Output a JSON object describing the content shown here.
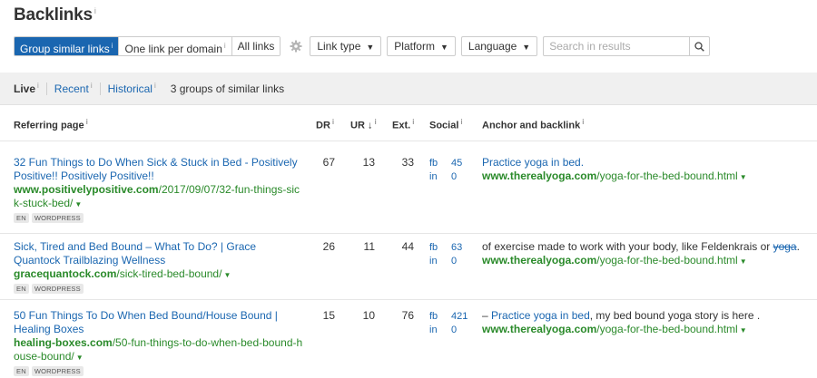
{
  "page": {
    "title": "Backlinks",
    "info": "i"
  },
  "toolbar": {
    "group_similar": "Group similar links",
    "one_per_domain": "One link per domain",
    "all_links": "All links",
    "info": "i",
    "link_type": "Link type",
    "platform": "Platform",
    "language": "Language",
    "search_placeholder": "Search in results",
    "active_color": "#1a66b0"
  },
  "tabs": {
    "live": "Live",
    "recent": "Recent",
    "historical": "Historical",
    "info": "i",
    "summary": "3 groups of similar links"
  },
  "columns": {
    "referring_page": "Referring page",
    "dr": "DR",
    "ur": "UR",
    "ur_sort": "↓",
    "ext": "Ext.",
    "social": "Social",
    "anchor": "Anchor and backlink",
    "info": "i"
  },
  "rows": [
    {
      "title": "32 Fun Things to Do When Sick & Stuck in Bed - Positively Positive!! Positively Positive!!",
      "domain": "www.positivelypositive.com",
      "path": "/2017/09/07/32-fun-things-sick-stuck-bed/",
      "tags": [
        "EN",
        "WORDPRESS"
      ],
      "dr": "67",
      "ur": "13",
      "ext": "33",
      "fb_label": "fb",
      "fb": "45",
      "in_label": "in",
      "in": "0",
      "anchor_before": "",
      "anchor_link": "Practice yoga in bed.",
      "anchor_strike": "",
      "anchor_after": "",
      "backlink_domain": "www.therealyoga.com",
      "backlink_path": "/yoga-for-the-bed-bound.html"
    },
    {
      "title": "Sick, Tired and Bed Bound – What To Do? | Grace Quantock Trailblazing Wellness",
      "domain": "gracequantock.com",
      "path": "/sick-tired-bed-bound/",
      "tags": [
        "EN",
        "WORDPRESS"
      ],
      "dr": "26",
      "ur": "11",
      "ext": "44",
      "fb_label": "fb",
      "fb": "63",
      "in_label": "in",
      "in": "0",
      "anchor_before": "of exercise made to work with your body, like Feldenkrais or ",
      "anchor_link": "",
      "anchor_strike": "yoga",
      "anchor_after": ".",
      "backlink_domain": "www.therealyoga.com",
      "backlink_path": "/yoga-for-the-bed-bound.html"
    },
    {
      "title": "50 Fun Things To Do When Bed Bound/House Bound | Healing Boxes",
      "domain": "healing-boxes.com",
      "path": "/50-fun-things-to-do-when-bed-bound-house-bound/",
      "tags": [
        "EN",
        "WORDPRESS"
      ],
      "dr": "15",
      "ur": "10",
      "ext": "76",
      "fb_label": "fb",
      "fb": "421",
      "in_label": "in",
      "in": "0",
      "anchor_before": "– ",
      "anchor_link": "Practice yoga in bed",
      "anchor_strike": "",
      "anchor_after": ", my bed bound yoga story is here .",
      "backlink_domain": "www.therealyoga.com",
      "backlink_path": "/yoga-for-the-bed-bound.html"
    }
  ]
}
